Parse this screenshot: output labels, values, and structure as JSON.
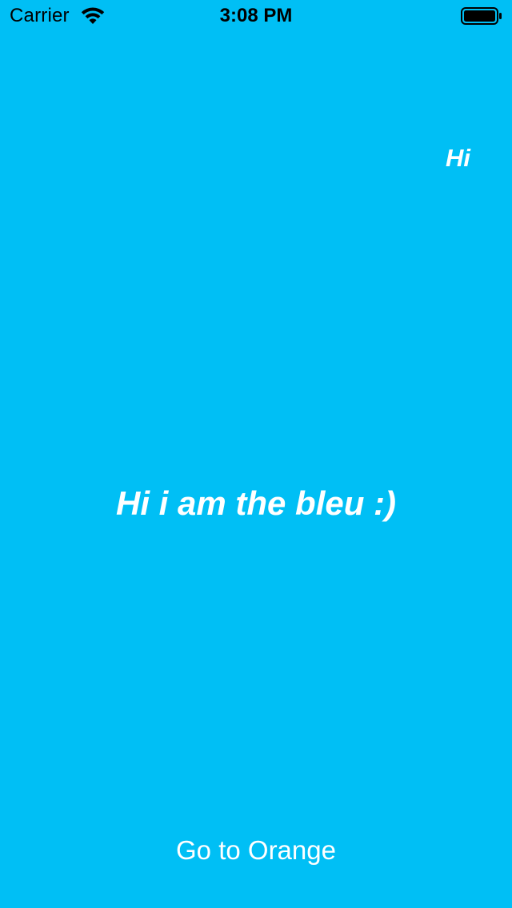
{
  "status_bar": {
    "carrier": "Carrier",
    "time": "3:08 PM",
    "wifi_icon": "wifi-icon",
    "battery_icon": "battery-full-icon"
  },
  "main": {
    "small_label": "Hi",
    "title": "Hi i am the bleu :)",
    "button_label": "Go to Orange"
  },
  "colors": {
    "background": "#00BFF5",
    "text": "#ffffff",
    "status_text": "#000000"
  }
}
